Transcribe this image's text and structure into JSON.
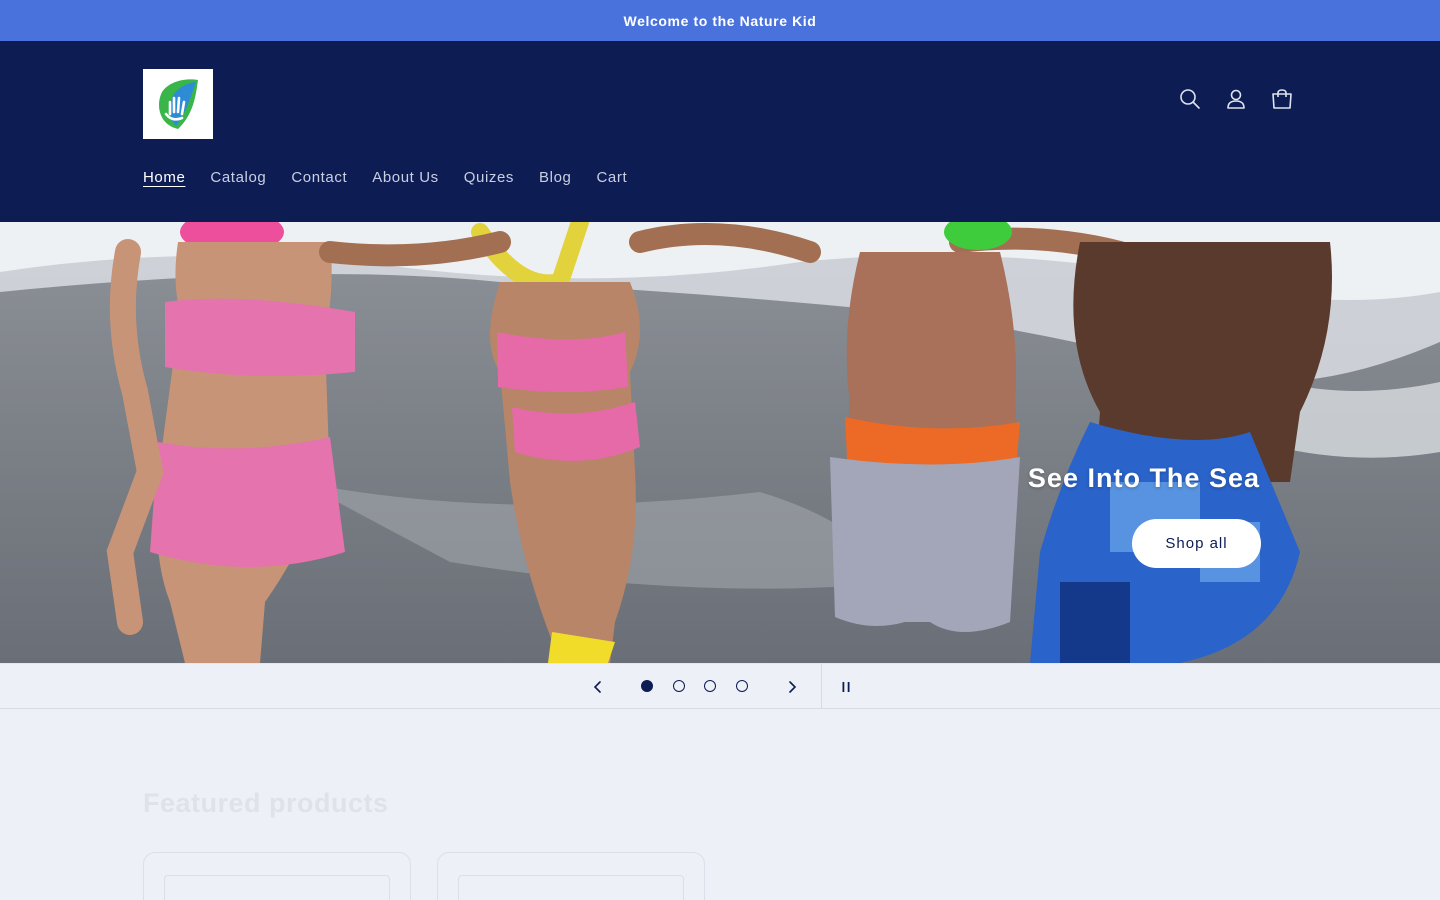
{
  "announcement": {
    "text": "Welcome to the Nature Kid"
  },
  "header": {
    "logo_alt": "Nature Kid logo",
    "icons": [
      "search-icon",
      "account-icon",
      "cart-icon"
    ],
    "nav": [
      {
        "label": "Home",
        "active": true
      },
      {
        "label": "Catalog",
        "active": false
      },
      {
        "label": "Contact",
        "active": false
      },
      {
        "label": "About Us",
        "active": false
      },
      {
        "label": "Quizes",
        "active": false
      },
      {
        "label": "Blog",
        "active": false
      },
      {
        "label": "Cart",
        "active": false
      }
    ]
  },
  "hero": {
    "title": "See Into The Sea",
    "button_label": "Shop all"
  },
  "slider": {
    "slides": 4,
    "current": 1,
    "prev_icon": "chevron-left-icon",
    "next_icon": "chevron-right-icon",
    "pause_icon": "pause-icon"
  },
  "featured": {
    "title": "Featured products"
  },
  "colors": {
    "announcement_bg": "#4a72dc",
    "header_bg": "#0e1c54",
    "page_bg": "#eef0f7"
  }
}
